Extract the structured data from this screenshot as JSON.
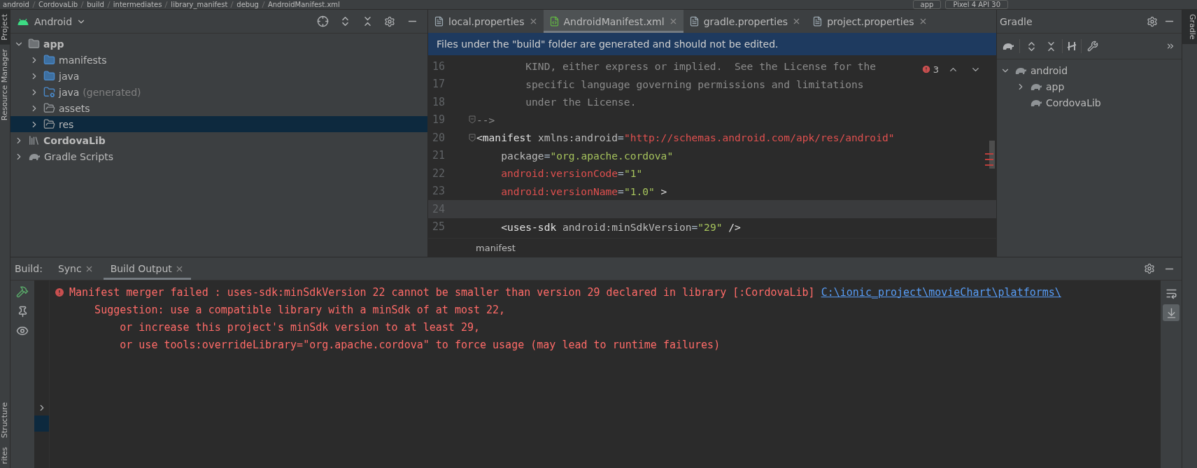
{
  "breadcrumb": [
    "android",
    "CordovaLib",
    "build",
    "intermediates",
    "library_manifest",
    "debug",
    "AndroidManifest.xml"
  ],
  "run_config": [
    "app",
    "Pixel 4 API 30"
  ],
  "side_tabs_left": [
    {
      "label": "Project",
      "selected": true
    },
    {
      "label": "Resource Manager",
      "selected": false
    },
    {
      "label": "Structure",
      "selected": false
    },
    {
      "label": "rites",
      "selected": false
    }
  ],
  "side_tabs_right": [
    {
      "label": "Gradle",
      "selected": true
    }
  ],
  "project": {
    "view": "Android",
    "tree": [
      {
        "label": "app",
        "kind": "module",
        "bold": true,
        "expanded": true,
        "selected": false,
        "children": [
          {
            "label": "manifests",
            "kind": "folder",
            "expanded": false,
            "selected": false
          },
          {
            "label": "java",
            "kind": "folder",
            "expanded": false,
            "selected": false
          },
          {
            "label": "java",
            "hint": "(generated)",
            "kind": "folder-gen",
            "expanded": false,
            "selected": false
          },
          {
            "label": "assets",
            "kind": "folder-res",
            "expanded": false,
            "selected": false
          },
          {
            "label": "res",
            "kind": "folder-res",
            "expanded": false,
            "selected": true
          }
        ]
      },
      {
        "label": "CordovaLib",
        "kind": "library",
        "bold": true,
        "expanded": false,
        "selected": false
      },
      {
        "label": "Gradle Scripts",
        "kind": "gradle",
        "expanded": false,
        "selected": false
      }
    ]
  },
  "editor": {
    "tabs": [
      {
        "label": "local.properties",
        "kind": "properties",
        "selected": false
      },
      {
        "label": "AndroidManifest.xml",
        "kind": "manifest",
        "selected": true
      },
      {
        "label": "gradle.properties",
        "kind": "properties",
        "selected": false
      },
      {
        "label": "project.properties",
        "kind": "properties",
        "selected": false
      }
    ],
    "banner": "Files under the \"build\" folder are generated and should not be edited.",
    "error_count": "3",
    "lines": [
      {
        "number": "16",
        "tokens": [
          {
            "kind": "comment",
            "text": "        KIND, either express or implied.  See the License for the"
          }
        ]
      },
      {
        "number": "17",
        "tokens": [
          {
            "kind": "comment",
            "text": "        specific language governing permissions and limitations"
          }
        ]
      },
      {
        "number": "18",
        "tokens": [
          {
            "kind": "comment",
            "text": "        under the License."
          }
        ]
      },
      {
        "number": "19",
        "fold": true,
        "tokens": [
          {
            "kind": "comment",
            "text": "-->"
          }
        ]
      },
      {
        "number": "20",
        "fold": true,
        "tokens": [
          {
            "kind": "tag",
            "text": "<manifest "
          },
          {
            "kind": "attr",
            "text": "xmlns:android"
          },
          {
            "kind": "plain",
            "text": "="
          },
          {
            "kind": "error",
            "text": "\"http://schemas.android.com/apk/res/android\""
          }
        ]
      },
      {
        "number": "21",
        "tokens": [
          {
            "kind": "attr",
            "text": "    package"
          },
          {
            "kind": "plain",
            "text": "="
          },
          {
            "kind": "string",
            "text": "\"org.apache.cordova\""
          }
        ]
      },
      {
        "number": "22",
        "tokens": [
          {
            "kind": "error",
            "text": "    android:versionCode"
          },
          {
            "kind": "plain",
            "text": "="
          },
          {
            "kind": "string",
            "text": "\"1\""
          }
        ]
      },
      {
        "number": "23",
        "tokens": [
          {
            "kind": "error",
            "text": "    android:versionName"
          },
          {
            "kind": "plain",
            "text": "="
          },
          {
            "kind": "string",
            "text": "\"1.0\""
          },
          {
            "kind": "tag",
            "text": " >"
          }
        ]
      },
      {
        "number": "24",
        "current": true
      },
      {
        "number": "25",
        "tokens": [
          {
            "kind": "tag",
            "text": "    <uses-sdk "
          },
          {
            "kind": "attr",
            "text": "android:minSdkVersion"
          },
          {
            "kind": "plain",
            "text": "="
          },
          {
            "kind": "string",
            "text": "\"29\""
          },
          {
            "kind": "tag",
            "text": " />"
          }
        ]
      }
    ],
    "footer": "manifest"
  },
  "gradle": {
    "title": "Gradle",
    "tree": [
      {
        "label": "android",
        "expanded": true,
        "children": [
          {
            "label": "app",
            "expanded": false
          },
          {
            "label": "CordovaLib"
          }
        ]
      }
    ]
  },
  "build": {
    "label": "Build:",
    "tabs": [
      {
        "label": "Sync",
        "selected": false
      },
      {
        "label": "Build Output",
        "selected": true
      }
    ],
    "output": [
      {
        "kind": "error",
        "text": "Manifest merger failed : uses-sdk:minSdkVersion 22 cannot be smaller than version 29 declared in library [:CordovaLib] ",
        "link": "C:\\ionic_project\\movieChart\\platforms\\"
      },
      {
        "kind": "text",
        "text": "    Suggestion: use a compatible library with a minSdk of at most 22,"
      },
      {
        "kind": "text",
        "text": "        or increase this project's minSdk version to at least 29,"
      },
      {
        "kind": "text",
        "text": "        or use tools:overrideLibrary=\"org.apache.cordova\" to force usage (may lead to runtime failures)"
      }
    ],
    "toggles": [
      {
        "kind": "soft-wrap",
        "on": false
      },
      {
        "kind": "scroll-end",
        "on": true
      }
    ]
  }
}
